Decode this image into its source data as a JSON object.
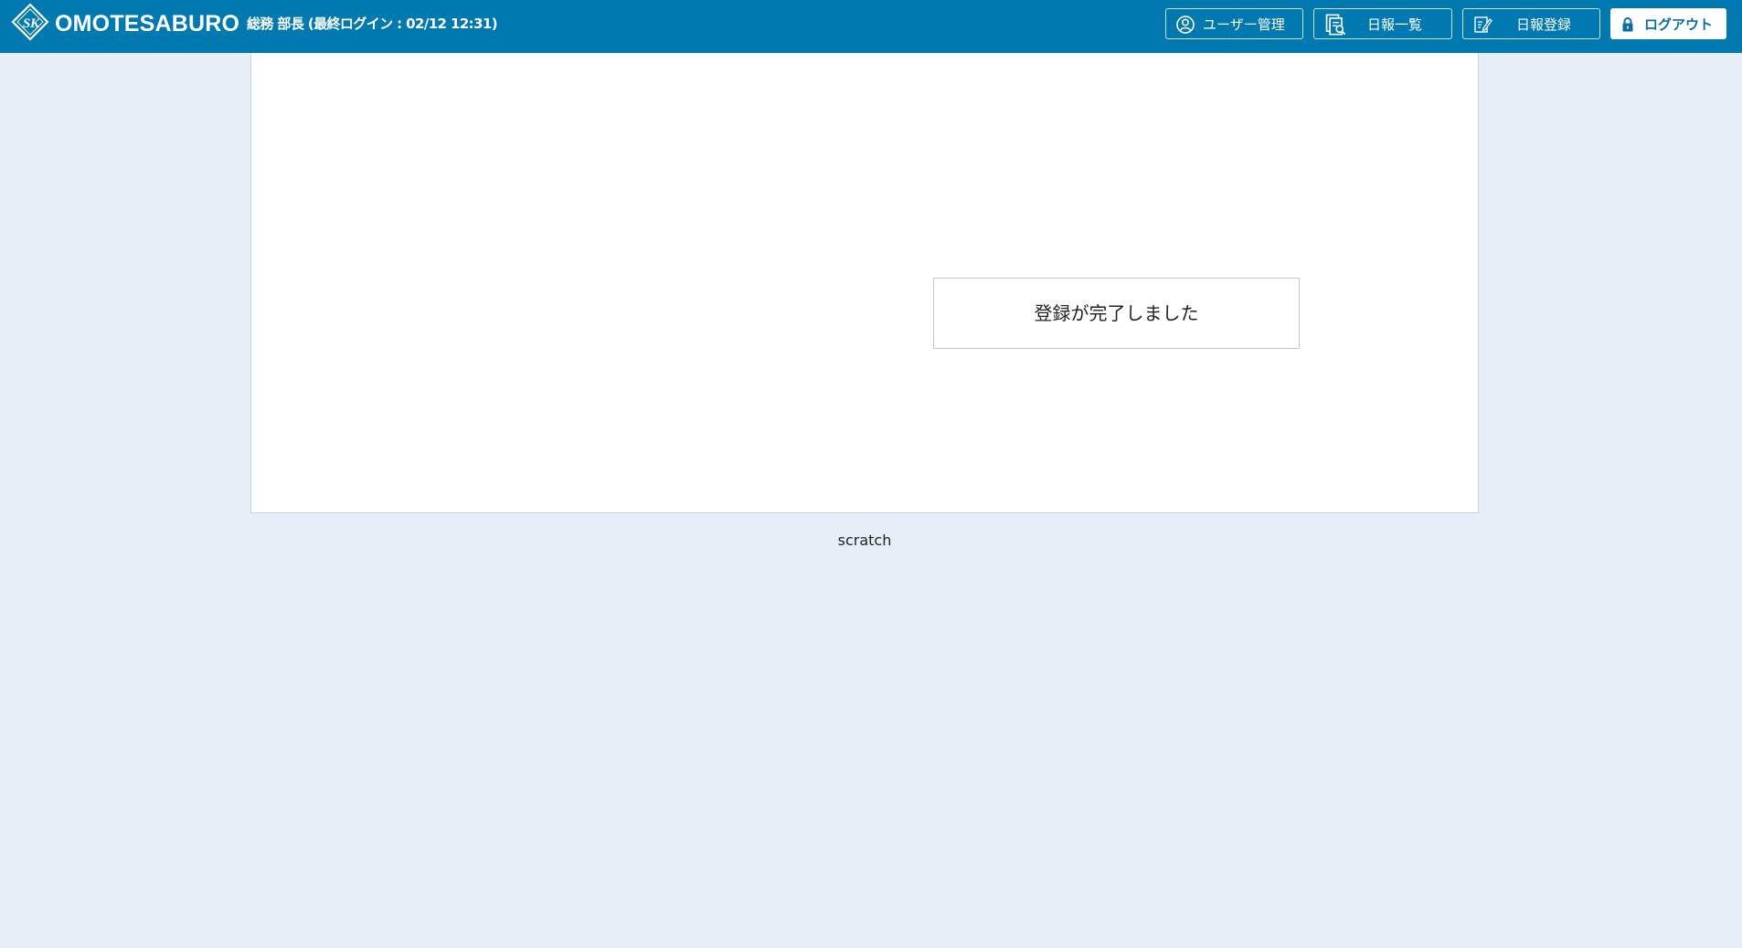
{
  "header": {
    "brand": "OMOTESABURO",
    "user_info": "総務 部長 (最終ログイン : 02/12 12:31)",
    "logo_icon": "sk-diamond-logo-icon",
    "background_color": "#0079b0"
  },
  "nav": {
    "users_label": "ユーザー管理",
    "users_icon": "user-circle-icon",
    "report_list_label": "日報一覧",
    "report_list_icon": "document-search-icon",
    "report_register_label": "日報登録",
    "report_register_icon": "edit-note-icon",
    "logout_label": "ログアウト",
    "logout_icon": "lock-icon"
  },
  "main": {
    "message": "登録が完了しました"
  },
  "footer": {
    "text": "scratch"
  }
}
